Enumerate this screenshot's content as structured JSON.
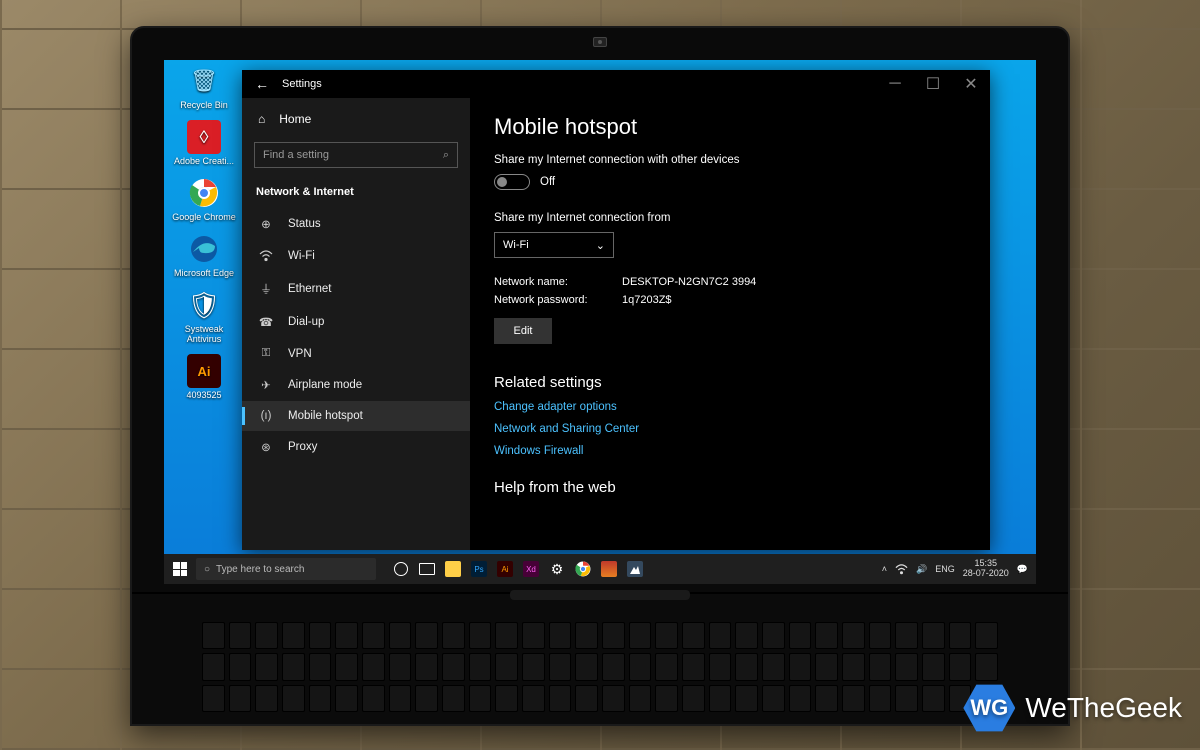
{
  "watermark": {
    "prefix": "WG",
    "text": "WeTheGeek"
  },
  "desktop_icons": [
    {
      "label": "Recycle Bin",
      "color": "#3ba9e0",
      "glyph": "♻"
    },
    {
      "label": "Adobe Creati...",
      "color": "#da1f26",
      "glyph": "✶"
    },
    {
      "label": "Google Chrome",
      "color": "#fff",
      "glyph": "◉"
    },
    {
      "label": "Microsoft Edge",
      "color": "#fff",
      "glyph": "◎"
    },
    {
      "label": "Systweak Antivirus",
      "color": "#fff",
      "glyph": "❖"
    },
    {
      "label": "4093525",
      "color": "#ff9a00",
      "glyph": "Ai"
    }
  ],
  "taskbar": {
    "search_placeholder": "Type here to search",
    "lang": "ENG",
    "time": "15:35",
    "date": "28-07-2020"
  },
  "settings": {
    "title": "Settings",
    "home": "Home",
    "search_placeholder": "Find a setting",
    "section": "Network & Internet",
    "nav": [
      {
        "icon": "status",
        "label": "Status"
      },
      {
        "icon": "wifi",
        "label": "Wi-Fi"
      },
      {
        "icon": "ethernet",
        "label": "Ethernet"
      },
      {
        "icon": "dialup",
        "label": "Dial-up"
      },
      {
        "icon": "vpn",
        "label": "VPN"
      },
      {
        "icon": "airplane",
        "label": "Airplane mode"
      },
      {
        "icon": "hotspot",
        "label": "Mobile hotspot",
        "active": true
      },
      {
        "icon": "proxy",
        "label": "Proxy"
      }
    ],
    "content": {
      "heading": "Mobile hotspot",
      "share_label": "Share my Internet connection with other devices",
      "toggle_state": "Off",
      "share_from_label": "Share my Internet connection from",
      "dropdown_value": "Wi-Fi",
      "network_name_label": "Network name:",
      "network_name_value": "DESKTOP-N2GN7C2 3994",
      "network_password_label": "Network password:",
      "network_password_value": "1q7203Z$",
      "edit_button": "Edit",
      "related_heading": "Related settings",
      "links": [
        "Change adapter options",
        "Network and Sharing Center",
        "Windows Firewall"
      ],
      "help_heading": "Help from the web"
    }
  }
}
